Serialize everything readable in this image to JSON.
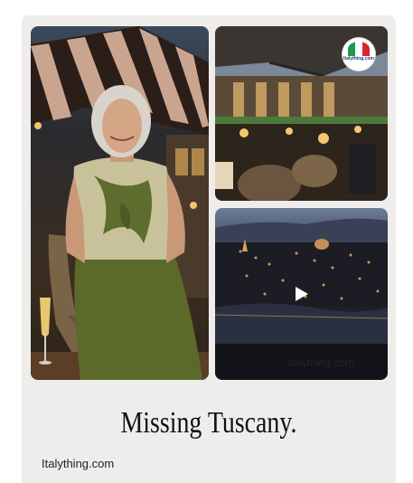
{
  "pin": {
    "title": "Missing Tuscany.",
    "source_link": "Italything.com"
  },
  "images": {
    "left": {
      "description": "woman-in-green-skirt"
    },
    "top_right": {
      "badge_text": "Italything.com"
    },
    "bottom_right": {
      "watermark": "Italything.com"
    }
  },
  "colors": {
    "card_background": "#efedeb",
    "page_background": "#ffffff",
    "text": "#111111"
  }
}
